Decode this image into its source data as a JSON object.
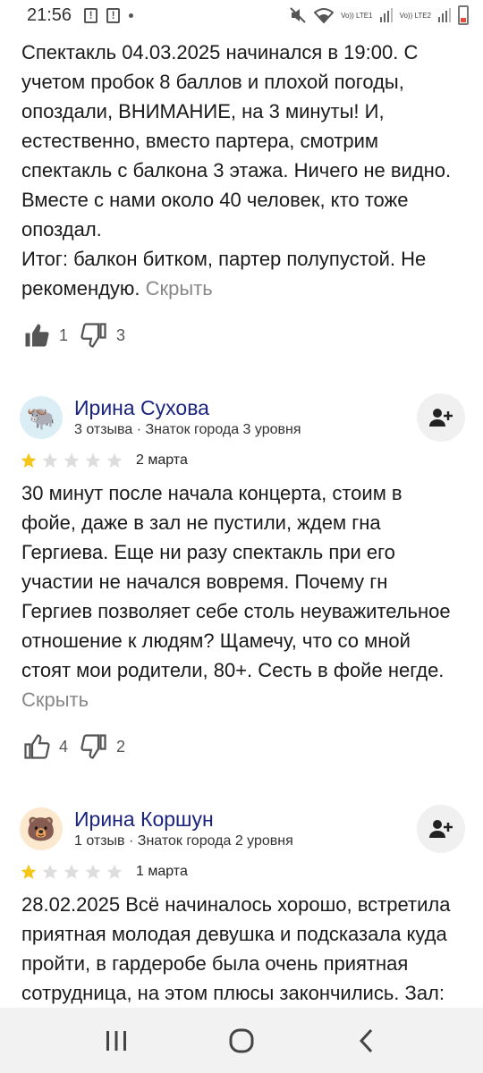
{
  "status": {
    "time": "21:56",
    "net1": "Vo)) LTE1",
    "net2": "Vo)) LTE2"
  },
  "review0": {
    "text": "Спектакль 04.03.2025 начинался в 19:00. С учетом пробок 8 баллов и плохой погоды, опоздали, ВНИМАНИЕ, на 3 минуты! И, естественно, вместо партера, смотрим спектакль с балкона 3 этажа. Ничего не видно. Вместе с нами около 40 человек, кто тоже опоздал.\nИтог: балкон битком, партер полупустой. Не рекомендую.",
    "hide": "Скрыть",
    "likes": "1",
    "dislikes": "3"
  },
  "review1": {
    "name": "Ирина Сухова",
    "meta": "3 отзыва · Знаток города 3 уровня",
    "avatar_icon": "yak-emoji",
    "rating": 1,
    "date": "2 марта",
    "text": "30 минут после начала концерта, стоим в фойе, даже в зал не пустили, ждем гна Гергиева. Еще ни разу спектакль при его участии не начался вовремя. Почему гн Гергиев позволяет себе столь неуважительное отношение к людям? Щамечу, что со мной стоят мои родители, 80+. Сесть в фойе негде.",
    "hide": "Скрыть",
    "likes": "4",
    "dislikes": "2"
  },
  "review2": {
    "name": "Ирина Коршун",
    "meta": "1 отзыв · Знаток города 2 уровня",
    "avatar_icon": "bear-emoji",
    "rating": 1,
    "date": "1 марта",
    "text": "28.02.2025 Всё начиналось хорошо, встретила приятная молодая девушка и подсказала куда пройти, в гардеробе была очень приятная сотрудница, на этом плюсы закончились. Зал: на стульях бирки с"
  },
  "colors": {
    "star_filled": "#f5c518",
    "star_empty": "#dddddd",
    "name": "#1a237e"
  }
}
